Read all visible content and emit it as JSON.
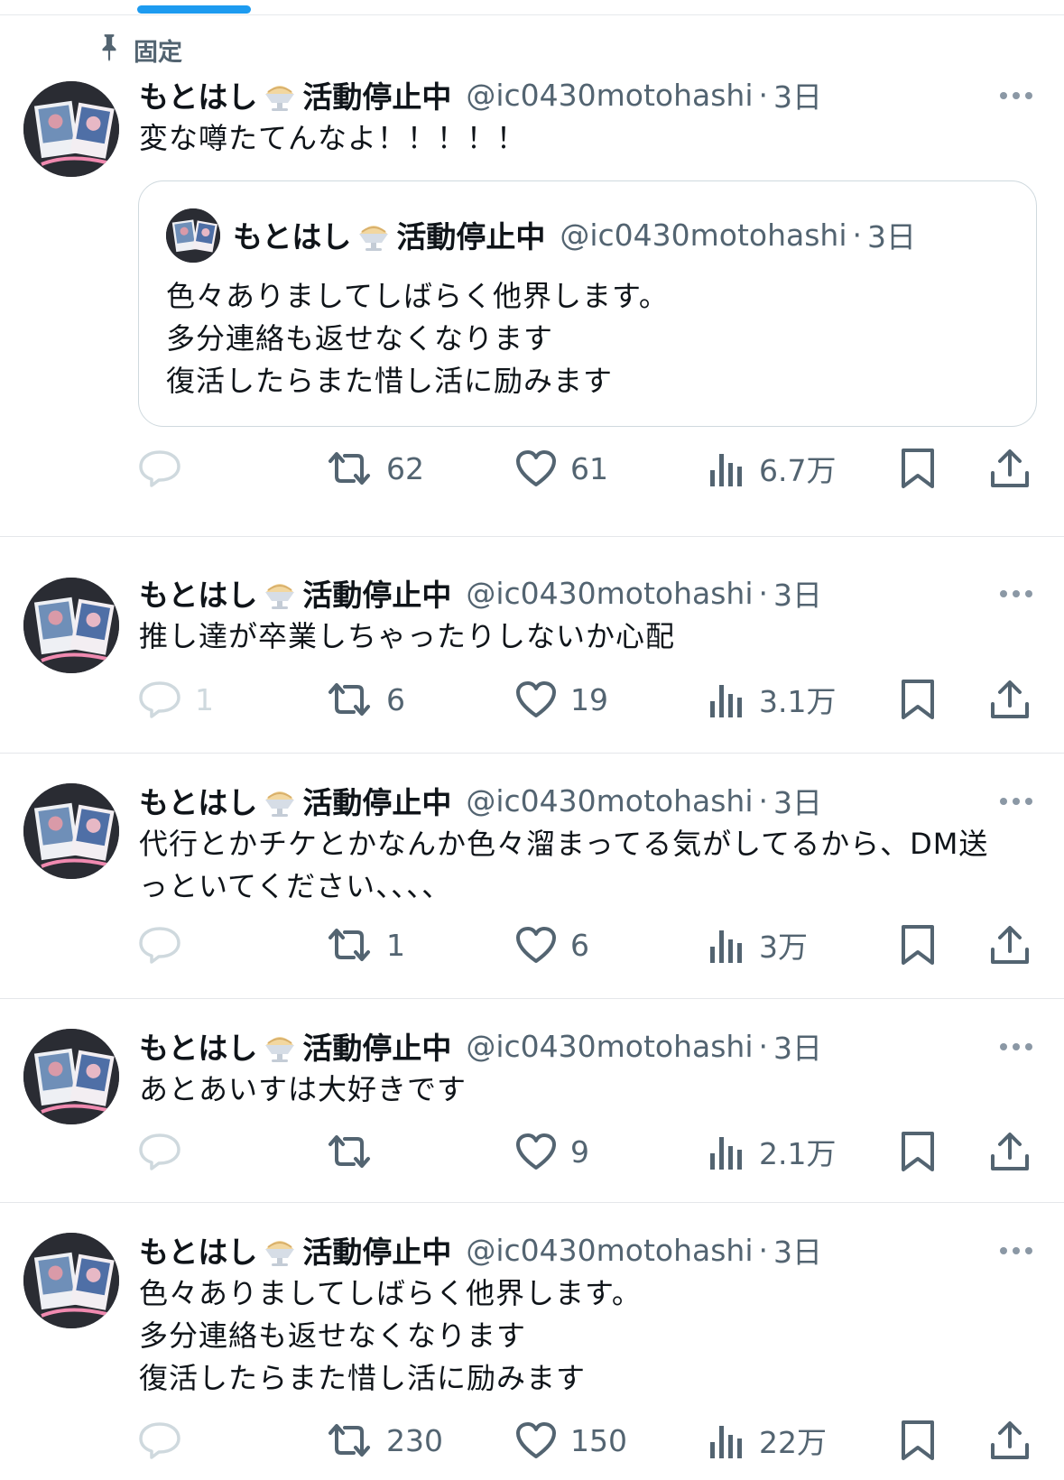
{
  "pinned_label": "固定",
  "author": {
    "name": "もとはし",
    "status": "活動停止中",
    "handle": "@ic0430motohashi",
    "emoji_icon": "shaved-ice-icon"
  },
  "tweets": [
    {
      "pinned": true,
      "time": "3日",
      "text": "変な噂たてんなよ！！！！！",
      "quote": {
        "name": "もとはし",
        "status": "活動停止中",
        "handle": "@ic0430motohashi",
        "time": "3日",
        "text": "色々ありましてしばらく他界します。\n多分連絡も返せなくなります\n復活したらまた惜し活に励みます"
      },
      "replies": "",
      "retweets": "62",
      "likes": "61",
      "views": "6.7万"
    },
    {
      "time": "3日",
      "text": "推し達が卒業しちゃったりしないか心配",
      "replies": "1",
      "retweets": "6",
      "likes": "19",
      "views": "3.1万"
    },
    {
      "time": "3日",
      "text": "代行とかチケとかなんか色々溜まってる気がしてるから、DM送\nっといてください、、、、",
      "replies": "",
      "retweets": "1",
      "likes": "6",
      "views": "3万"
    },
    {
      "time": "3日",
      "text": "あとあいすは大好きです",
      "replies": "",
      "retweets": "",
      "likes": "9",
      "views": "2.1万"
    },
    {
      "time": "3日",
      "text": "色々ありましてしばらく他界します。\n多分連絡も返せなくなります\n復活したらまた惜し活に励みます",
      "replies": "",
      "retweets": "230",
      "likes": "150",
      "views": "22万"
    }
  ],
  "colors": {
    "accent": "#1d9bf0",
    "text": "#0f1419",
    "secondary": "#536471",
    "divider": "#e4e7ea"
  }
}
